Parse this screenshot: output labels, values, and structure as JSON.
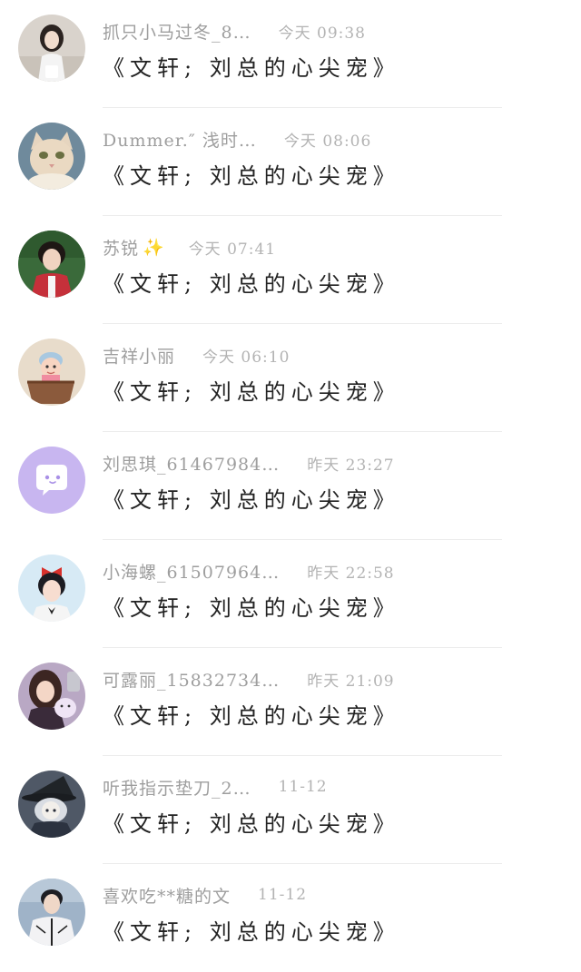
{
  "messages": [
    {
      "name": "抓只小马过冬_8…",
      "badge": "",
      "time": "今天 09:38",
      "text": "《文轩; 刘总的心尖宠》",
      "avatar_icon": "girl-portrait-icon",
      "avatar_bg": "#d9d3cc"
    },
    {
      "name": "Dummer.″ 浅时…",
      "badge": "",
      "time": "今天 08:06",
      "text": "《文轩; 刘总的心尖宠》",
      "avatar_icon": "cat-icon",
      "avatar_bg": "#6f8a9c"
    },
    {
      "name": "苏锐",
      "badge": "✨",
      "time": "今天 07:41",
      "text": "《文轩; 刘总的心尖宠》",
      "avatar_icon": "boy-portrait-icon",
      "avatar_bg": "#3a6a3a"
    },
    {
      "name": "吉祥小丽",
      "badge": "",
      "time": "今天 06:10",
      "text": "《文轩; 刘总的心尖宠》",
      "avatar_icon": "baby-portrait-icon",
      "avatar_bg": "#e8dccb"
    },
    {
      "name": "刘思琪_61467984…",
      "badge": "",
      "time": "昨天 23:27",
      "text": "《文轩; 刘总的心尖宠》",
      "avatar_icon": "chat-bubble-icon",
      "avatar_bg": "#c8b6f0"
    },
    {
      "name": "小海螺_61507964…",
      "badge": "",
      "time": "昨天 22:58",
      "text": "《文轩; 刘总的心尖宠》",
      "avatar_icon": "boy-with-bow-icon",
      "avatar_bg": "#d7eaf5"
    },
    {
      "name": "可露丽_15832734…",
      "badge": "",
      "time": "昨天 21:09",
      "text": "《文轩; 刘总的心尖宠》",
      "avatar_icon": "girl-with-toy-icon",
      "avatar_bg": "#b9a8c4"
    },
    {
      "name": "听我指示垫刀_2…",
      "badge": "",
      "time": "11-12",
      "text": "《文轩; 刘总的心尖宠》",
      "avatar_icon": "witch-character-icon",
      "avatar_bg": "#4f5866"
    },
    {
      "name": "喜欢吃**糖的文",
      "badge": "",
      "time": "11-12",
      "text": "《文轩; 刘总的心尖宠》",
      "avatar_icon": "boy-in-jacket-icon",
      "avatar_bg": "#9fb3c8"
    }
  ]
}
